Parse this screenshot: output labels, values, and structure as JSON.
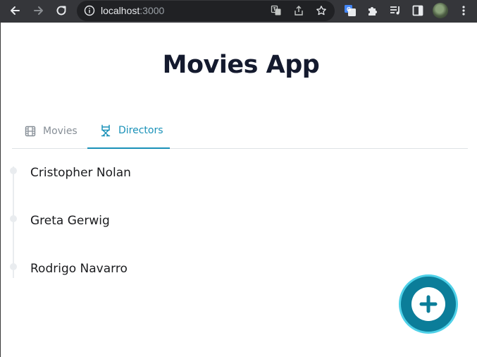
{
  "browser": {
    "url_host": "localhost",
    "url_port": ":3000"
  },
  "app": {
    "title": "Movies App"
  },
  "tabs": [
    {
      "label": "Movies",
      "icon": "film-icon",
      "active": false
    },
    {
      "label": "Directors",
      "icon": "director-chair-icon",
      "active": true
    }
  ],
  "directors": [
    {
      "name": "Cristopher Nolan"
    },
    {
      "name": "Greta Gerwig"
    },
    {
      "name": "Rodrigo Navarro"
    }
  ],
  "colors": {
    "accent": "#1991b8",
    "fab": "#0b7d99",
    "fab_ring": "#4fd1e8",
    "title": "#141a2e"
  },
  "fab": {
    "icon": "plus-icon"
  }
}
